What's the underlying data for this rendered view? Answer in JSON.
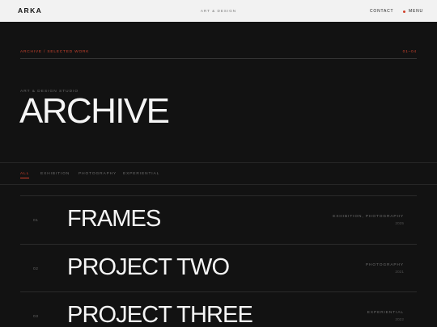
{
  "header": {
    "logo": "ARKA",
    "tagline": "ART & DESIGN",
    "contact_label": "CONTACT",
    "menu_label": "MENU"
  },
  "breadcrumb": {
    "text": "ARCHIVE / SELECTED WORK",
    "range": "01–04"
  },
  "hero": {
    "kicker": "ART & DESIGN STUDIO",
    "title": "ARCHIVE"
  },
  "filters": [
    {
      "label": "ALL",
      "active": true
    },
    {
      "label": "EXHIBITION",
      "active": false
    },
    {
      "label": "PHOTOGRAPHY",
      "active": false
    },
    {
      "label": "EXPERIENTIAL",
      "active": false
    }
  ],
  "projects": [
    {
      "num": "01",
      "title": "FRAMES",
      "category": "EXHIBITION, PHOTOGRAPHY",
      "year": "2025"
    },
    {
      "num": "02",
      "title": "PROJECT TWO",
      "category": "PHOTOGRAPHY",
      "year": "2021"
    },
    {
      "num": "03",
      "title": "PROJECT THREE",
      "category": "EXPERIENTIAL",
      "year": "2022"
    }
  ],
  "colors": {
    "accent": "#d0402b",
    "background": "#121212",
    "header_bg": "#f2f2f2"
  }
}
